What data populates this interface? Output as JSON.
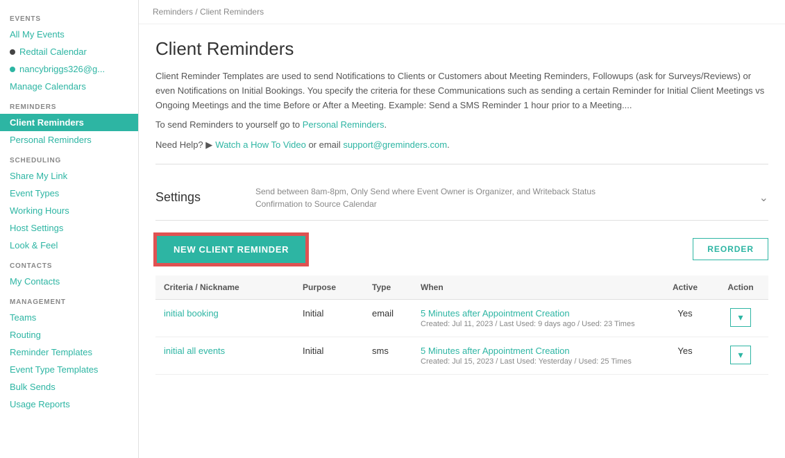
{
  "sidebar": {
    "sections": [
      {
        "label": "EVENTS",
        "items": [
          {
            "id": "all-my-events",
            "text": "All My Events",
            "type": "link",
            "active": false
          },
          {
            "id": "redtail-calendar",
            "text": "Redtail Calendar",
            "type": "dot-dark",
            "active": false
          },
          {
            "id": "nancybriggs",
            "text": "nancybriggs326@g...",
            "type": "dot-teal",
            "active": false
          },
          {
            "id": "manage-calendars",
            "text": "Manage Calendars",
            "type": "link",
            "active": false
          }
        ]
      },
      {
        "label": "REMINDERS",
        "items": [
          {
            "id": "client-reminders",
            "text": "Client Reminders",
            "type": "link",
            "active": true
          },
          {
            "id": "personal-reminders",
            "text": "Personal Reminders",
            "type": "link",
            "active": false
          }
        ]
      },
      {
        "label": "SCHEDULING",
        "items": [
          {
            "id": "share-my-link",
            "text": "Share My Link",
            "type": "link",
            "active": false
          },
          {
            "id": "event-types",
            "text": "Event Types",
            "type": "link",
            "active": false
          },
          {
            "id": "working-hours",
            "text": "Working Hours",
            "type": "link",
            "active": false
          },
          {
            "id": "host-settings",
            "text": "Host Settings",
            "type": "link",
            "active": false
          },
          {
            "id": "look-and-feel",
            "text": "Look & Feel",
            "type": "link",
            "active": false
          }
        ]
      },
      {
        "label": "CONTACTS",
        "items": [
          {
            "id": "my-contacts",
            "text": "My Contacts",
            "type": "link",
            "active": false
          }
        ]
      },
      {
        "label": "MANAGEMENT",
        "items": [
          {
            "id": "teams",
            "text": "Teams",
            "type": "link",
            "active": false
          },
          {
            "id": "routing",
            "text": "Routing",
            "type": "link",
            "active": false
          },
          {
            "id": "reminder-templates",
            "text": "Reminder Templates",
            "type": "link",
            "active": false
          },
          {
            "id": "event-type-templates",
            "text": "Event Type Templates",
            "type": "link",
            "active": false
          },
          {
            "id": "bulk-sends",
            "text": "Bulk Sends",
            "type": "link",
            "active": false
          },
          {
            "id": "usage-reports",
            "text": "Usage Reports",
            "type": "link",
            "active": false
          }
        ]
      }
    ]
  },
  "breadcrumb": {
    "items": [
      "Reminders",
      "Client Reminders"
    ],
    "separator": "/"
  },
  "header": {
    "title": "Client Reminders",
    "description": "Client Reminder Templates are used to send Notifications to Clients or Customers about Meeting Reminders, Followups (ask for Surveys/Reviews) or even Notifications on Initial Bookings. You specify the criteria for these Communications such as sending a certain Reminder for Initial Client Meetings vs Ongoing Meetings and the time Before or After a Meeting. Example: Send a SMS Reminder 1 hour prior to a Meeting....",
    "personal_reminders_text": "To send Reminders to yourself go to ",
    "personal_reminders_link": "Personal Reminders",
    "help_text": "Need Help? ",
    "watch_video_text": "Watch a How To Video",
    "or_email_text": " or email ",
    "support_email": "support@greminders.com"
  },
  "settings": {
    "label": "Settings",
    "value_line1": "Send between 8am-8pm, Only Send where Event Owner is Organizer, and Writeback Status",
    "value_line2": "Confirmation to Source Calendar"
  },
  "actions": {
    "new_button_label": "NEW CLIENT REMINDER",
    "reorder_button_label": "REORDER"
  },
  "table": {
    "columns": [
      "Criteria / Nickname",
      "Purpose",
      "Type",
      "When",
      "Active",
      "Action"
    ],
    "rows": [
      {
        "criteria": "initial booking",
        "purpose": "Initial",
        "type": "email",
        "when_main": "5 Minutes after Appointment Creation",
        "when_sub": "Created: Jul 11, 2023 / Last Used: 9 days ago / Used: 23 Times",
        "active": "Yes",
        "action": "▾"
      },
      {
        "criteria": "initial all events",
        "purpose": "Initial",
        "type": "sms",
        "when_main": "5 Minutes after Appointment Creation",
        "when_sub": "Created: Jul 15, 2023 / Last Used: Yesterday / Used: 25 Times",
        "active": "Yes",
        "action": "▾"
      }
    ]
  }
}
